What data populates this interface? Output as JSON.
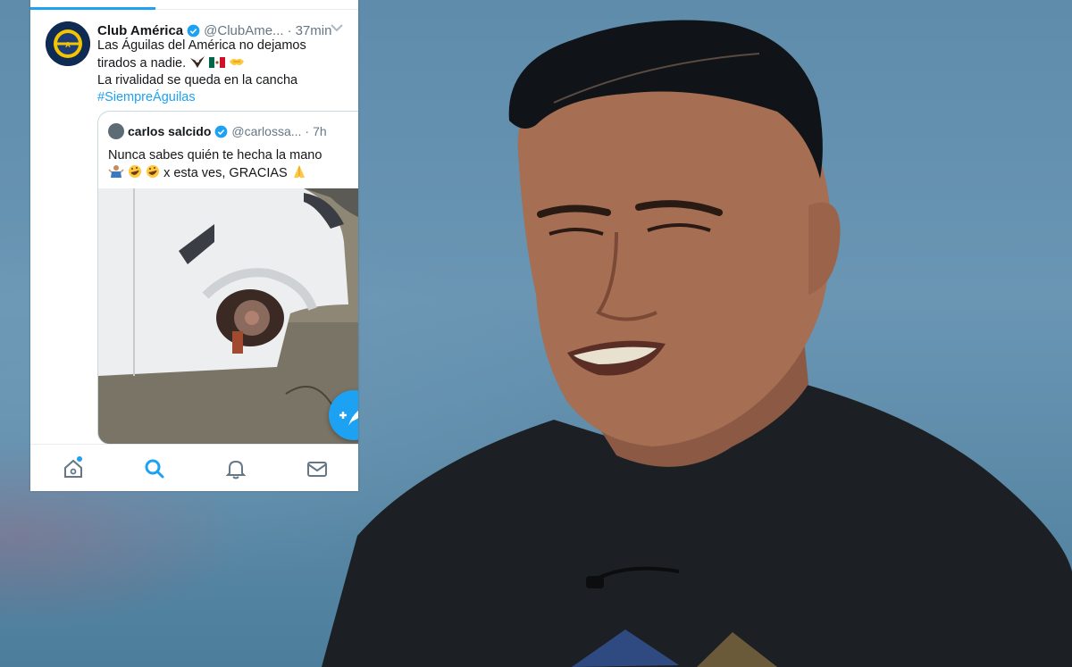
{
  "tweet": {
    "author_name": "Club América",
    "author_handle": "@ClubAme...",
    "time": "37min",
    "line1": "Las Águilas del América no dejamos",
    "line2": "tirados a nadie.",
    "line3": "La rivalidad se queda en la cancha",
    "hashtag": "#SiempreÁguilas",
    "emojis": [
      "eagle",
      "mexico-flag",
      "handshake"
    ]
  },
  "quote": {
    "author_name": "carlos salcido",
    "author_handle": "@carlossa...",
    "time": "7h",
    "line1": "Nunca sabes quién te hecha la mano",
    "line2": "x esta ves,  GRACIAS",
    "emojis_before": [
      "person-shrugging",
      "rofl",
      "rofl"
    ],
    "emojis_after": [
      "folded-hands"
    ]
  },
  "nav": {
    "items": [
      "home-icon",
      "search-icon",
      "notifications-icon",
      "messages-icon"
    ],
    "active": "search-icon"
  },
  "colors": {
    "twitter_blue": "#1da1f2",
    "text_dark": "#14171a",
    "text_gray": "#657786"
  }
}
